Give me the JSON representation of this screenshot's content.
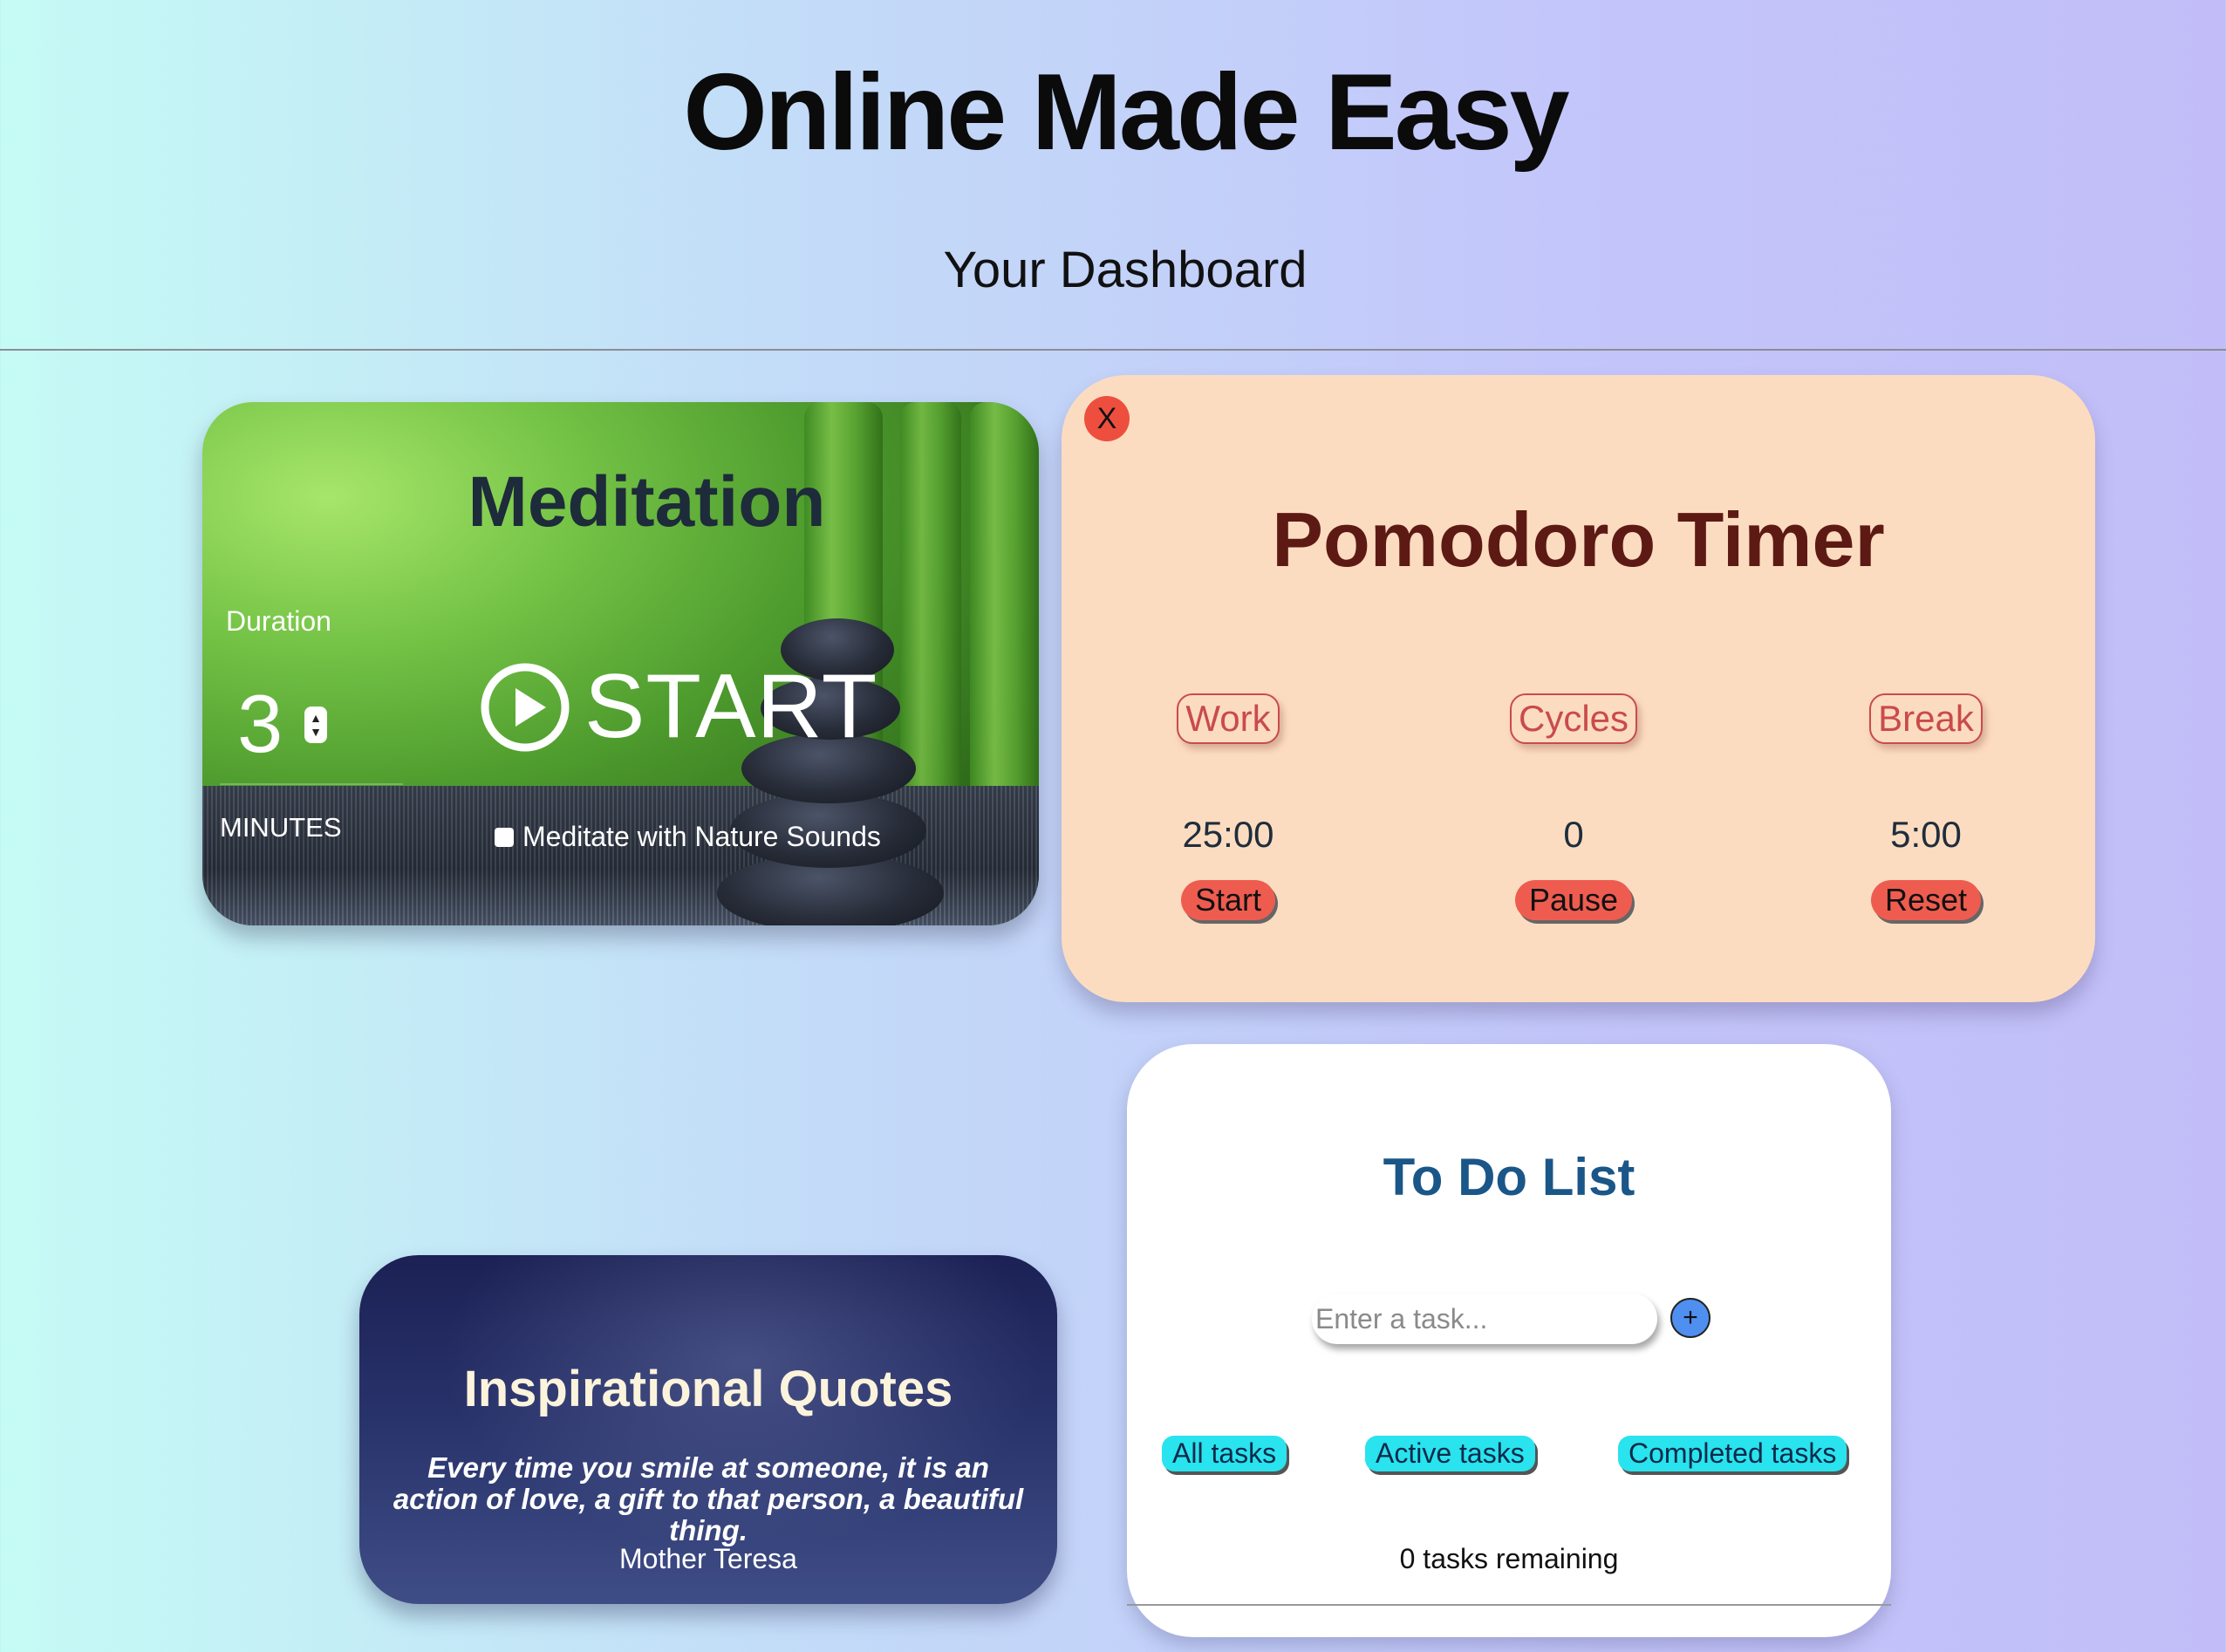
{
  "header": {
    "title": "Online Made Easy",
    "subtitle": "Your Dashboard"
  },
  "meditation": {
    "title": "Meditation",
    "duration_label": "Duration",
    "duration_value": "3",
    "unit_label": "MINUTES",
    "start_label": "START",
    "nature_sounds_label": "Meditate with Nature Sounds",
    "nature_sounds_checked": false
  },
  "pomodoro": {
    "close_label": "X",
    "title": "Pomodoro Timer",
    "columns": [
      {
        "label": "Work",
        "value": "25:00",
        "button": "Start"
      },
      {
        "label": "Cycles",
        "value": "0",
        "button": "Pause"
      },
      {
        "label": "Break",
        "value": "5:00",
        "button": "Reset"
      }
    ]
  },
  "quotes": {
    "title": "Inspirational Quotes",
    "text": "Every time you smile at someone, it is an action of love, a gift to that person, a beautiful thing.",
    "author": "Mother Teresa"
  },
  "todo": {
    "title": "To Do List",
    "input_placeholder": "Enter a task...",
    "add_label": "+",
    "filters": [
      "All tasks",
      "Active tasks",
      "Completed tasks"
    ],
    "remaining": "0 tasks remaining"
  },
  "colors": {
    "pomodoro_bg": "#fcdcc0",
    "pomodoro_title": "#5d1a14",
    "pomodoro_button": "#ee5c50",
    "todo_title": "#1a5688",
    "todo_filter": "#29e3ee",
    "todo_add": "#4f8ff0",
    "close_button": "#ee4e3e"
  },
  "icons": {
    "start": "play-circle-icon",
    "stepper": "stepper-arrows-icon",
    "add": "plus-icon"
  }
}
